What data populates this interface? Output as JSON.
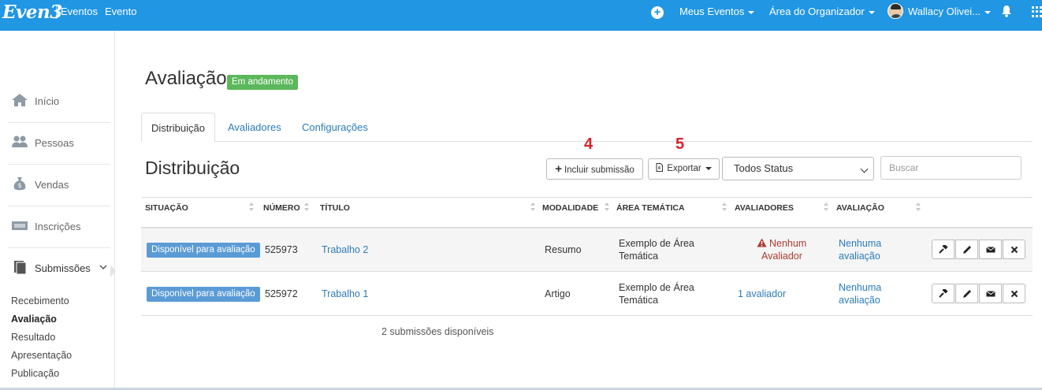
{
  "topbar": {
    "logo": "Even3",
    "nav_links": [
      "Eventos",
      "Evento"
    ],
    "meus_eventos": "Meus Eventos",
    "area_organizador": "Área do Organizador",
    "user_name": "Wallacy Olivei...",
    "accent_color": "#2196e3"
  },
  "sidebar": {
    "items": [
      {
        "label": "Início",
        "icon": "home-icon"
      },
      {
        "label": "Pessoas",
        "icon": "people-icon"
      },
      {
        "label": "Vendas",
        "icon": "money-bag-icon"
      },
      {
        "label": "Inscrições",
        "icon": "ticket-icon"
      },
      {
        "label": "Submissões",
        "icon": "documents-icon"
      }
    ],
    "submenu": [
      "Recebimento",
      "Avaliação",
      "Resultado",
      "Apresentação",
      "Publicação"
    ],
    "active_submenu": "Avaliação"
  },
  "page": {
    "title": "Avaliação",
    "status_badge": "Em andamento",
    "tabs": [
      "Distribuição",
      "Avaliadores",
      "Configurações"
    ],
    "active_tab": "Distribuição",
    "section_title": "Distribuição",
    "annotations": [
      "4",
      "5"
    ]
  },
  "toolbar": {
    "include_label": "Incluir submissão",
    "export_label": "Exportar",
    "status_select": "Todos Status",
    "search_placeholder": "Buscar"
  },
  "table": {
    "headers": [
      "SITUAÇÃO",
      "NÚMERO",
      "TÍTULO",
      "MODALIDADE",
      "ÁREA TEMÁTICA",
      "AVALIADORES",
      "AVALIAÇÃO"
    ],
    "rows": [
      {
        "situacao": "Disponível para avaliação",
        "numero": "525973",
        "titulo": "Trabalho 2",
        "modalidade": "Resumo",
        "area_l1": "Exemplo de Área",
        "area_l2": "Temática",
        "avaliadores_l1": "Nenhum",
        "avaliadores_l2": "Avaliador",
        "avaliadores_warning": true,
        "avaliacao_l1": "Nenhuma",
        "avaliacao_l2": "avaliação"
      },
      {
        "situacao": "Disponível para avaliação",
        "numero": "525972",
        "titulo": "Trabalho 1",
        "modalidade": "Artigo",
        "area_l1": "Exemplo de Área",
        "area_l2": "Temática",
        "avaliadores_l1": "1 avaliador",
        "avaliadores_l2": "",
        "avaliadores_warning": false,
        "avaliacao_l1": "Nenhuma",
        "avaliacao_l2": "avaliação"
      }
    ],
    "action_icons": [
      "gavel-icon",
      "pencil-icon",
      "envelope-icon",
      "close-icon"
    ],
    "footer": "2 submissões disponíveis"
  }
}
